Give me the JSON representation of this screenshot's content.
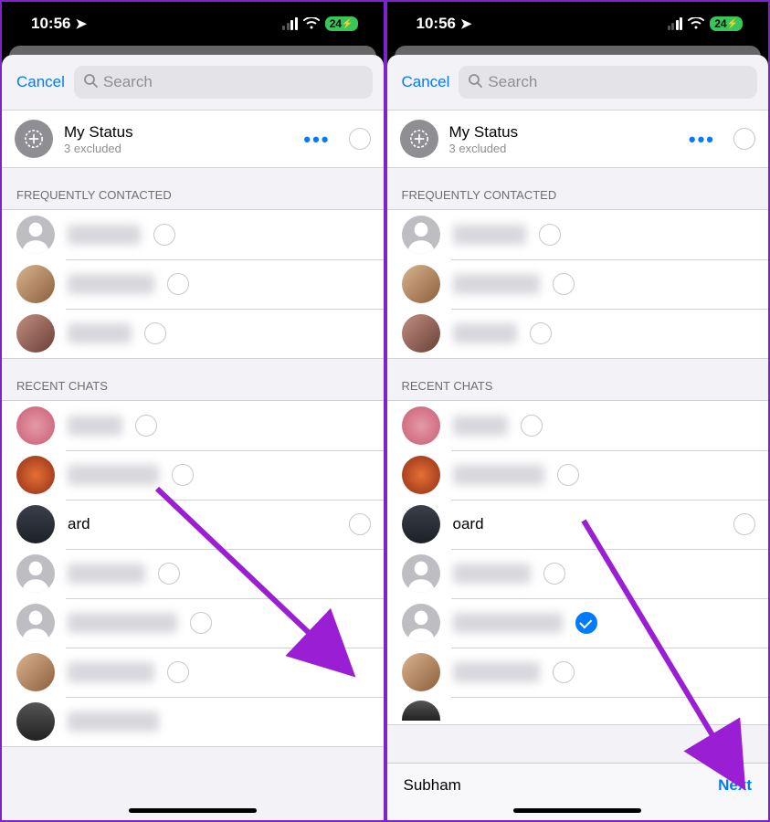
{
  "status_bar": {
    "time": "10:56",
    "battery": "24"
  },
  "header": {
    "cancel": "Cancel",
    "search_placeholder": "Search"
  },
  "my_status": {
    "title": "My Status",
    "subtitle": "3 excluded"
  },
  "sections": {
    "frequent": "Frequently Contacted",
    "recent": "Recent Chats"
  },
  "left": {
    "recent_text_row": "ard"
  },
  "right": {
    "recent_text_row": "oard",
    "bottom_name": "Subham",
    "next": "Next"
  }
}
